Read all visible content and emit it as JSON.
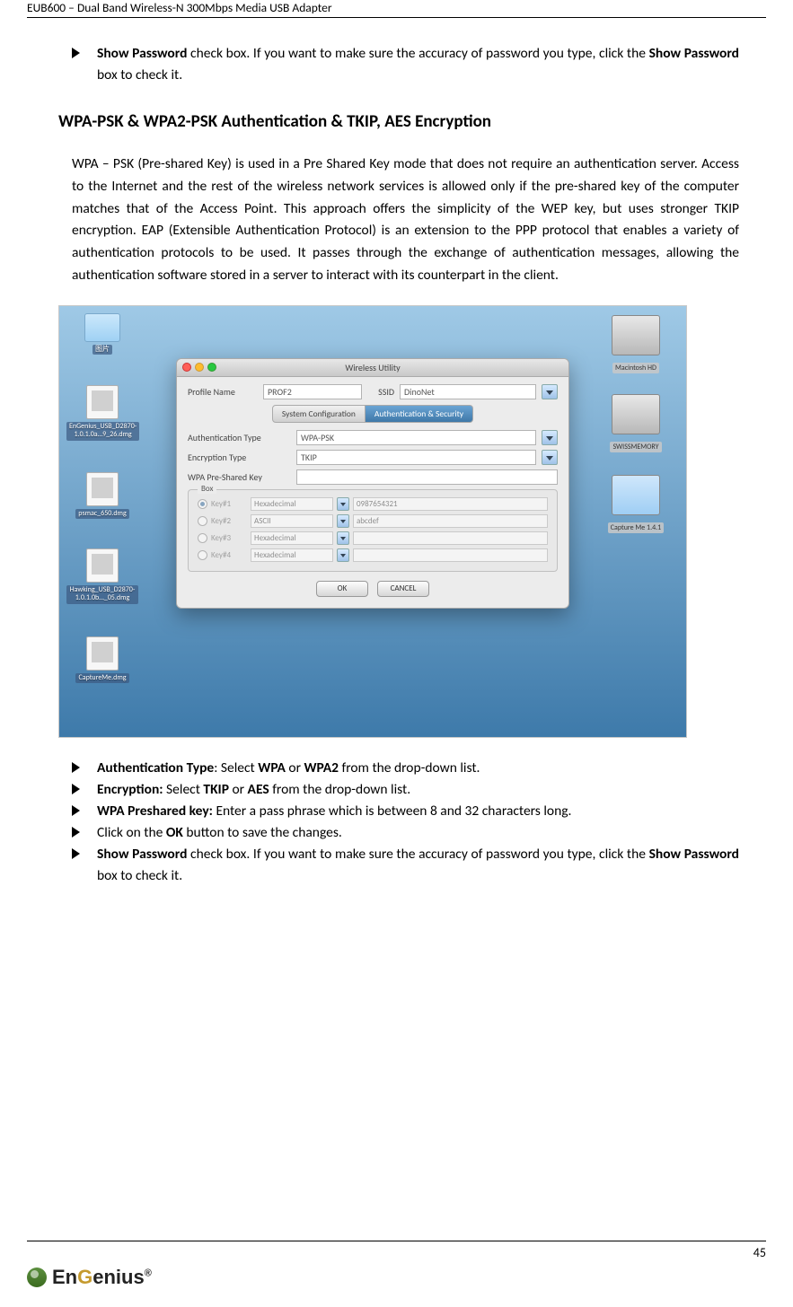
{
  "header": {
    "title": "EUB600 – Dual Band Wireless-N 300Mbps Media USB Adapter"
  },
  "top_bullet": {
    "prefix_bold": "Show Password",
    "text_a": " check box. If you want to make sure the accuracy of password you type, click the ",
    "mid_bold": "Show Password",
    "text_b": " box to check it."
  },
  "heading": "WPA-PSK & WPA2-PSK Authentication & TKIP, AES Encryption",
  "paragraph": "WPA – PSK (Pre-shared Key) is used in a Pre Shared Key mode that does not require an authentication server.  Access to the Internet and the rest of the wireless network services is allowed only if the pre-shared key of the computer matches that of the Access Point.  This approach offers the simplicity of the WEP key, but uses stronger TKIP encryption. EAP (Extensible Authentication Protocol) is an extension to the PPP protocol that enables a variety of authentication protocols to be used. It passes through the exchange of authentication messages, allowing the authentication software stored in a server to interact with its counterpart in the client.",
  "desktop_icons": {
    "folder": "图片",
    "dmg1": "EnGenius_USB_D2870-1.0.1.0a…9_26.dmg",
    "dmg2": "psmac_650.dmg",
    "dmg3": "Hawking_USB_D2870-1.0.1.0b…_05.dmg",
    "dmg4": "CaptureMe.dmg",
    "right1": "Macintosh HD",
    "right2": "SWISSMEMORY",
    "right3": "Capture Me 1.4.1"
  },
  "dialog": {
    "title": "Wireless Utility",
    "profile_label": "Profile Name",
    "profile_value": "PROF2",
    "ssid_label": "SSID",
    "ssid_value": "DinoNet",
    "tab1": "System Configuration",
    "tab2": "Authentication & Security",
    "auth_type_label": "Authentication Type",
    "auth_type_value": "WPA-PSK",
    "enc_type_label": "Encryption Type",
    "enc_type_value": "TKIP",
    "psk_label": "WPA Pre-Shared Key",
    "box_label": "Box",
    "keys": [
      {
        "label": "Key#1",
        "mode": "Hexadecimal",
        "value": "0987654321",
        "sel": true
      },
      {
        "label": "Key#2",
        "mode": "ASCII",
        "value": "abcdef",
        "sel": false
      },
      {
        "label": "Key#3",
        "mode": "Hexadecimal",
        "value": "",
        "sel": false
      },
      {
        "label": "Key#4",
        "mode": "Hexadecimal",
        "value": "",
        "sel": false
      }
    ],
    "ok": "OK",
    "cancel": "CANCEL"
  },
  "bullets": {
    "b1a": "Authentication Type",
    "b1b": ": Select ",
    "b1c": "WPA",
    "b1d": " or ",
    "b1e": "WPA2",
    "b1f": " from the drop-down list.",
    "b2a": "Encryption:",
    "b2b": " Select ",
    "b2c": "TKIP",
    "b2d": " or ",
    "b2e": "AES",
    "b2f": " from the drop-down list.",
    "b3a": "WPA Preshared key:",
    "b3b": " Enter a pass phrase which is between 8 and 32 characters long.",
    "b4a": "Click on the ",
    "b4b": "OK",
    "b4c": " button to save the changes.",
    "b5a": "Show Password",
    "b5b": " check box. If you want to make sure the accuracy of password you type, click the ",
    "b5c": "Show Password",
    "b5d": " box to check it."
  },
  "page_number": "45",
  "logo": {
    "part1": "En",
    "part2": "G",
    "part3": "enius",
    "reg": "®"
  }
}
